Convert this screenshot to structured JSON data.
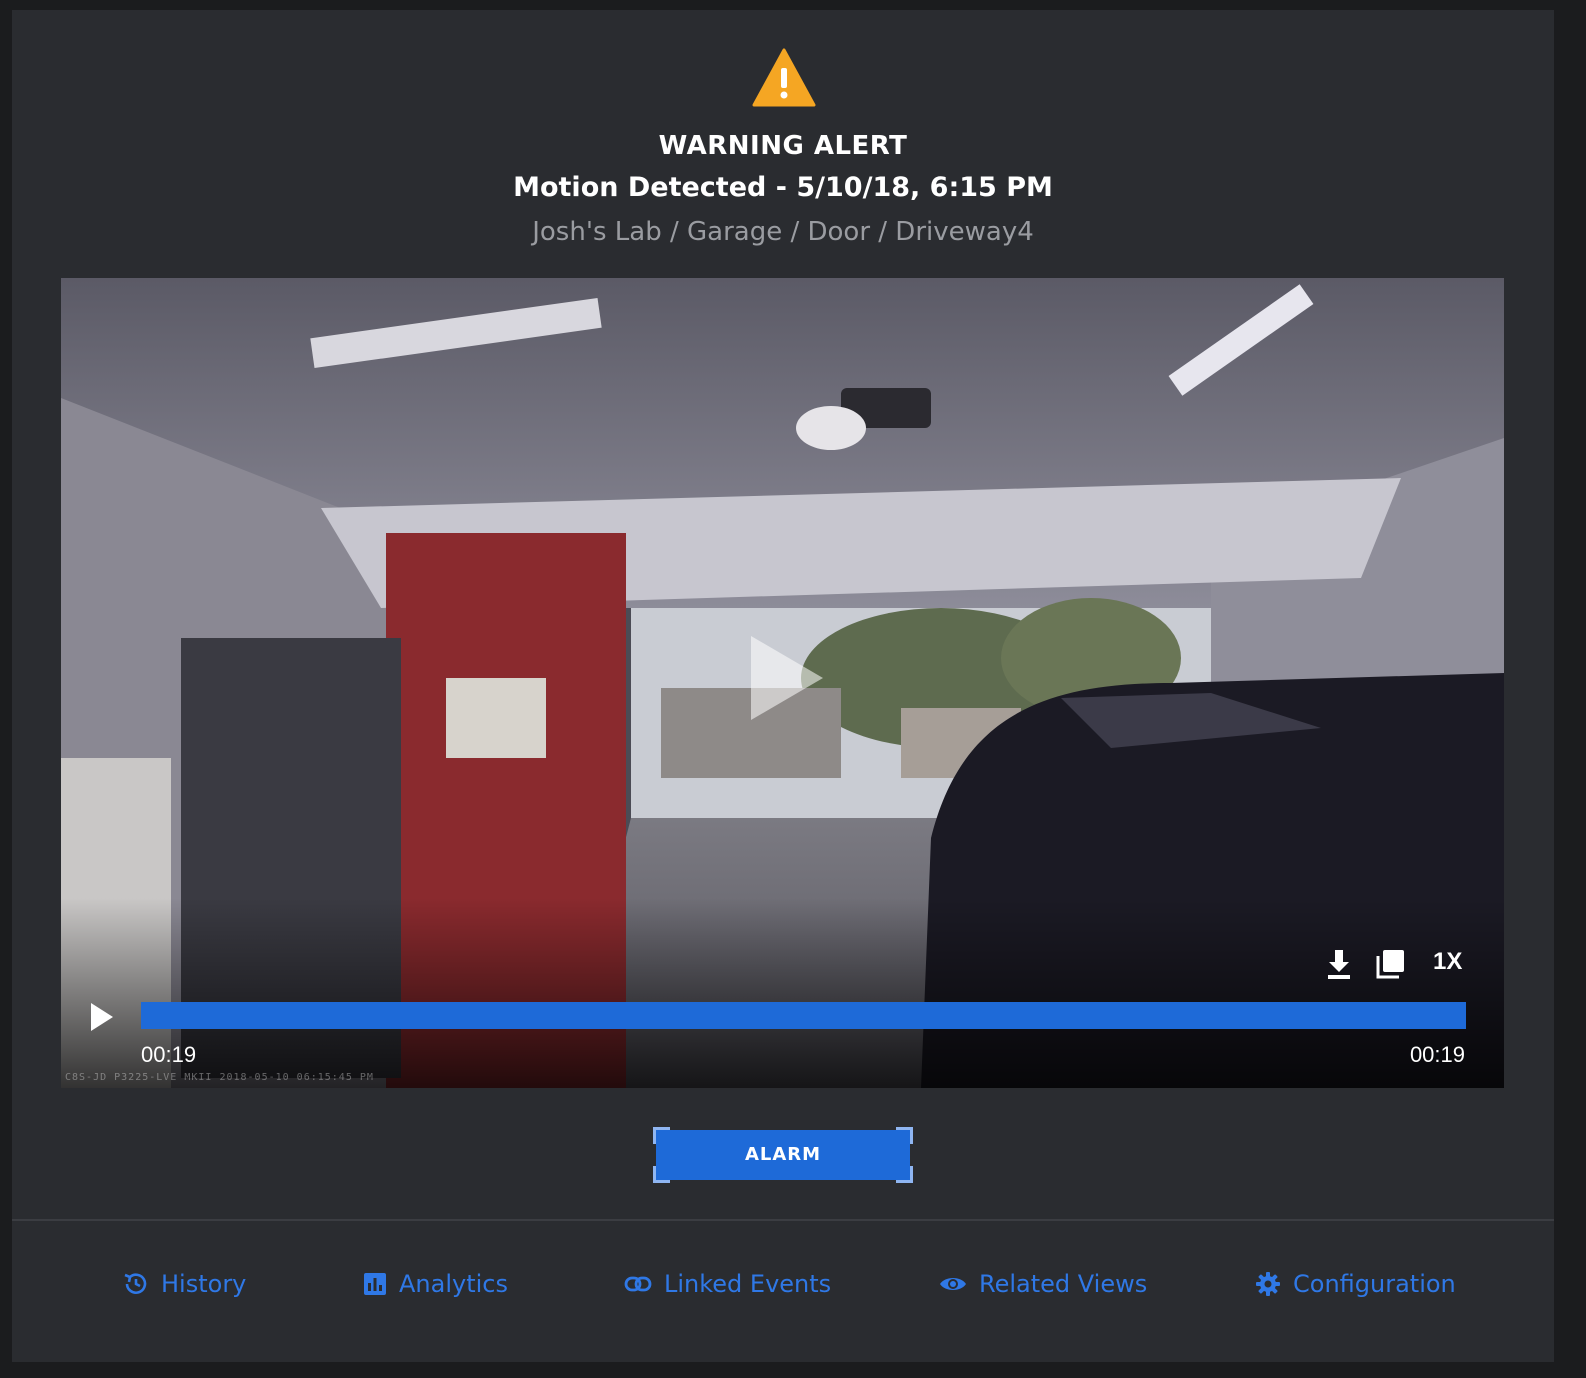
{
  "alert": {
    "level": "WARNING ALERT",
    "title": "Motion Detected - 5/10/18, 6:15 PM",
    "path": "Josh's Lab / Garage / Door / Driveway4",
    "icon": "warning-triangle-icon",
    "icon_color": "#f5a623"
  },
  "video": {
    "time_current": "00:19",
    "time_total": "00:19",
    "speed": "1X",
    "progress_fraction": 1.0,
    "camera_overlay": "C8S-JD P3225-LVE MKII 2018-05-10 06:15:45 PM",
    "progress_color": "#1e6ad8"
  },
  "actions": {
    "alarm_label": "ALARM"
  },
  "footer_nav": [
    {
      "label": "History",
      "icon": "history-icon"
    },
    {
      "label": "Analytics",
      "icon": "analytics-icon"
    },
    {
      "label": "Linked Events",
      "icon": "link-icon"
    },
    {
      "label": "Related Views",
      "icon": "eye-icon"
    },
    {
      "label": "Configuration",
      "icon": "gear-icon"
    }
  ],
  "colors": {
    "background": "#2a2c30",
    "accent": "#2f78e6",
    "muted_text": "#9a9ca1"
  }
}
